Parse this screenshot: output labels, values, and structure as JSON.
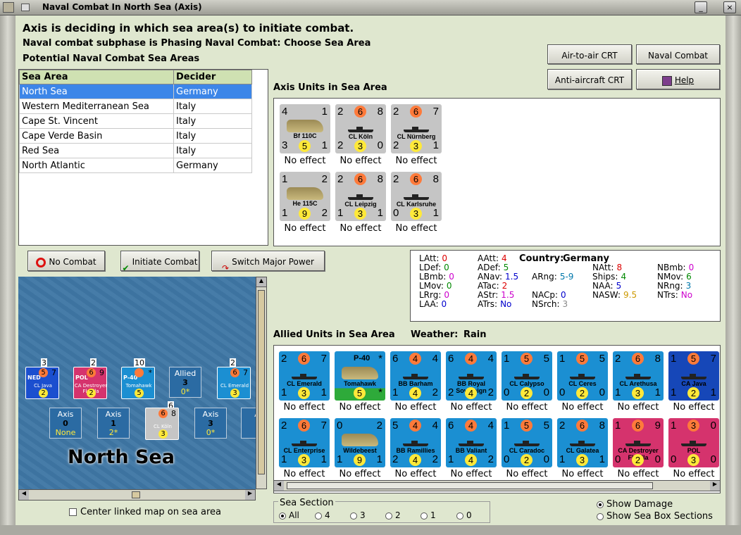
{
  "window": {
    "title": "Naval Combat In North Sea (Axis)"
  },
  "header": {
    "line1": "Axis is deciding in which sea area(s) to initiate combat.",
    "line2": "Naval combat subphase is Phasing Naval Combat: Choose Sea Area",
    "line3": "Potential Naval Combat Sea Areas"
  },
  "buttons": {
    "air_to_air": "Air-to-air CRT",
    "naval_chart": "Naval Combat Chart",
    "anti_aircraft": "Anti-aircraft CRT",
    "help": "Help",
    "no_combat": "No Combat",
    "initiate": "Initiate Combat",
    "switch": "Switch Major Power"
  },
  "sea_table": {
    "col1": "Sea Area",
    "col2": "Decider",
    "rows": [
      {
        "area": "North Sea",
        "decider": "Germany"
      },
      {
        "area": "Western Mediterranean Sea",
        "decider": "Italy"
      },
      {
        "area": "Cape St. Vincent",
        "decider": "Italy"
      },
      {
        "area": "Cape Verde Basin",
        "decider": "Italy"
      },
      {
        "area": "Red Sea",
        "decider": "Italy"
      },
      {
        "area": "North Atlantic",
        "decider": "Germany"
      }
    ]
  },
  "axis_units": {
    "label": "Axis Units in Sea Area",
    "units": [
      {
        "name": "Bf 110C",
        "tl": "4",
        "tm": "",
        "tr": "1",
        "bl": "3",
        "bm": "5",
        "br": "1",
        "effect": "No effect",
        "kind": "air"
      },
      {
        "name": "CL Köln",
        "tl": "2",
        "tm": "6",
        "tr": "8",
        "bl": "2",
        "bm": "3",
        "br": "0",
        "effect": "No effect",
        "kind": "ship"
      },
      {
        "name": "CL Nürnberg",
        "tl": "2",
        "tm": "6",
        "tr": "7",
        "bl": "2",
        "bm": "3",
        "br": "1",
        "effect": "No effect",
        "kind": "ship"
      },
      {
        "name": "He 115C",
        "tl": "1",
        "tm": "",
        "tr": "2",
        "bl": "1",
        "bm": "9",
        "br": "2",
        "effect": "No effect",
        "kind": "air"
      },
      {
        "name": "CL Leipzig",
        "tl": "2",
        "tm": "6",
        "tr": "8",
        "bl": "1",
        "bm": "3",
        "br": "1",
        "effect": "No effect",
        "kind": "ship"
      },
      {
        "name": "CL Karlsruhe",
        "tl": "2",
        "tm": "6",
        "tr": "8",
        "bl": "0",
        "bm": "3",
        "br": "1",
        "effect": "No effect",
        "kind": "ship"
      }
    ]
  },
  "stats": {
    "country_label": "Country:",
    "country": "Germany",
    "items": [
      {
        "k": "LAtt:",
        "v": "0",
        "c": "#d00"
      },
      {
        "k": "LDef:",
        "v": "0",
        "c": "#080"
      },
      {
        "k": "LBmb:",
        "v": "0",
        "c": "#c0c"
      },
      {
        "k": "LMov:",
        "v": "0",
        "c": "#080"
      },
      {
        "k": "LRrg:",
        "v": "0",
        "c": "#c0c"
      },
      {
        "k": "LAA:",
        "v": "0",
        "c": "#00c"
      },
      {
        "k": "AAtt:",
        "v": "4",
        "c": "#d00"
      },
      {
        "k": "ADef:",
        "v": "5",
        "c": "#080"
      },
      {
        "k": "ANav:",
        "v": "1.5",
        "c": "#00c"
      },
      {
        "k": "ATac:",
        "v": "2",
        "c": "#d00"
      },
      {
        "k": "AStr:",
        "v": "1.5",
        "c": "#c0c"
      },
      {
        "k": "ATrs:",
        "v": "No",
        "c": "#00c"
      },
      {
        "k": "ARng:",
        "v": "5-9",
        "c": "#07a"
      },
      {
        "k": "NACp:",
        "v": "0",
        "c": "#00c"
      },
      {
        "k": "NSrch:",
        "v": "3",
        "c": "#888"
      },
      {
        "k": "NAtt:",
        "v": "8",
        "c": "#d00"
      },
      {
        "k": "Ships:",
        "v": "4",
        "c": "#080"
      },
      {
        "k": "NAA:",
        "v": "5",
        "c": "#00c"
      },
      {
        "k": "NASW:",
        "v": "9.5",
        "c": "#c90"
      },
      {
        "k": "NBmb:",
        "v": "0",
        "c": "#c0c"
      },
      {
        "k": "NMov:",
        "v": "6",
        "c": "#080"
      },
      {
        "k": "NRng:",
        "v": "3",
        "c": "#07a"
      },
      {
        "k": "NTrs:",
        "v": "No",
        "c": "#c0c"
      }
    ]
  },
  "allied_units": {
    "label": "Allied Units in Sea Area",
    "weather_label": "Weather:",
    "weather": "Rain",
    "units": [
      {
        "name": "CL Emerald",
        "tl": "2",
        "tm": "6",
        "tr": "7",
        "bl": "1",
        "bm": "3",
        "br": "1",
        "effect": "No effect",
        "color": "blue"
      },
      {
        "name": "Tomahawk",
        "tl": "",
        "tm": "P-40",
        "tr": "*",
        "bl": "",
        "bm": "5",
        "br": "*",
        "effect": "No effect",
        "color": "blue"
      },
      {
        "name": "BB Barham",
        "tl": "6",
        "tm": "4",
        "tr": "4",
        "bl": "1",
        "bm": "4",
        "br": "2",
        "effect": "No effect",
        "color": "blue"
      },
      {
        "name": "BB Royal Sovereign",
        "tl": "6",
        "tm": "4",
        "tr": "4",
        "bl": "2",
        "bm": "4",
        "br": "2",
        "effect": "No effect",
        "color": "blue"
      },
      {
        "name": "CL Calypso",
        "tl": "1",
        "tm": "5",
        "tr": "5",
        "bl": "0",
        "bm": "2",
        "br": "0",
        "effect": "No effect",
        "color": "blue"
      },
      {
        "name": "CL Ceres",
        "tl": "1",
        "tm": "5",
        "tr": "5",
        "bl": "0",
        "bm": "2",
        "br": "0",
        "effect": "No effect",
        "color": "blue"
      },
      {
        "name": "CL Arethusa",
        "tl": "2",
        "tm": "6",
        "tr": "8",
        "bl": "1",
        "bm": "3",
        "br": "1",
        "effect": "No effect",
        "color": "blue"
      },
      {
        "name": "CA Java",
        "tl": "1",
        "tm": "5",
        "tr": "7",
        "bl": "1",
        "bm": "2",
        "br": "1",
        "effect": "No effect",
        "color": "navy"
      },
      {
        "name": "CL Enterprise",
        "tl": "2",
        "tm": "6",
        "tr": "7",
        "bl": "1",
        "bm": "3",
        "br": "1",
        "effect": "No effect",
        "color": "blue"
      },
      {
        "name": "Wildebeest",
        "tl": "0",
        "tm": "",
        "tr": "2",
        "bl": "1",
        "bm": "9",
        "br": "1",
        "effect": "No effect",
        "color": "blue"
      },
      {
        "name": "BB Ramillies",
        "tl": "5",
        "tm": "4",
        "tr": "4",
        "bl": "2",
        "bm": "4",
        "br": "2",
        "effect": "No effect",
        "color": "blue"
      },
      {
        "name": "BB Valiant",
        "tl": "6",
        "tm": "4",
        "tr": "4",
        "bl": "1",
        "bm": "4",
        "br": "2",
        "effect": "No effect",
        "color": "blue"
      },
      {
        "name": "CL Caradoc",
        "tl": "1",
        "tm": "5",
        "tr": "5",
        "bl": "0",
        "bm": "2",
        "br": "0",
        "effect": "No effect",
        "color": "blue"
      },
      {
        "name": "CL Galatea",
        "tl": "2",
        "tm": "6",
        "tr": "8",
        "bl": "1",
        "bm": "3",
        "br": "1",
        "effect": "No effect",
        "color": "blue"
      },
      {
        "name": "CA Destroyer Flotilla",
        "tl": "1",
        "tm": "6",
        "tr": "9",
        "bl": "0",
        "bm": "2",
        "br": "0",
        "effect": "No effect",
        "color": "red"
      },
      {
        "name": "POL",
        "tl": "1",
        "tm": "3",
        "tr": "0",
        "bl": "0",
        "bm": "3",
        "br": "0",
        "effect": "No effect",
        "color": "red"
      }
    ]
  },
  "map": {
    "sea_name": "North Sea",
    "stacks": [
      "3",
      "2",
      "10",
      "2",
      "6"
    ],
    "boxes": [
      {
        "side": "Allied",
        "num": "3",
        "sub": "0*"
      },
      {
        "side": "Axis",
        "num": "0",
        "sub": "None"
      },
      {
        "side": "Axis",
        "num": "1",
        "sub": "2*"
      },
      {
        "side": "Axis",
        "num": "3",
        "sub": "0*"
      },
      {
        "side": "A",
        "num": "",
        "sub": ""
      }
    ],
    "counters": [
      {
        "tag": "NED",
        "top": "5",
        "tr": "7",
        "name": "CL Java",
        "bm": "2"
      },
      {
        "tag": "POL",
        "top": "6",
        "tr": "9",
        "name": "CA Destroyer Flotilla",
        "bm": "2"
      },
      {
        "tag": "P-40",
        "top": "",
        "tr": "*",
        "name": "Tomahawk",
        "bm": "5"
      },
      {
        "tag": "",
        "top": "6",
        "tr": "7",
        "name": "CL Emerald",
        "bm": "3"
      },
      {
        "tag": "",
        "top": "6",
        "tr": "8",
        "name": "CL Köln",
        "bm": "3"
      }
    ]
  },
  "bottom": {
    "center_map": "Center linked map on sea area",
    "sea_section": "Sea Section",
    "sections": [
      "All",
      "4",
      "3",
      "2",
      "1",
      "0"
    ],
    "show_damage": "Show Damage",
    "show_boxes": "Show Sea Box Sections"
  }
}
